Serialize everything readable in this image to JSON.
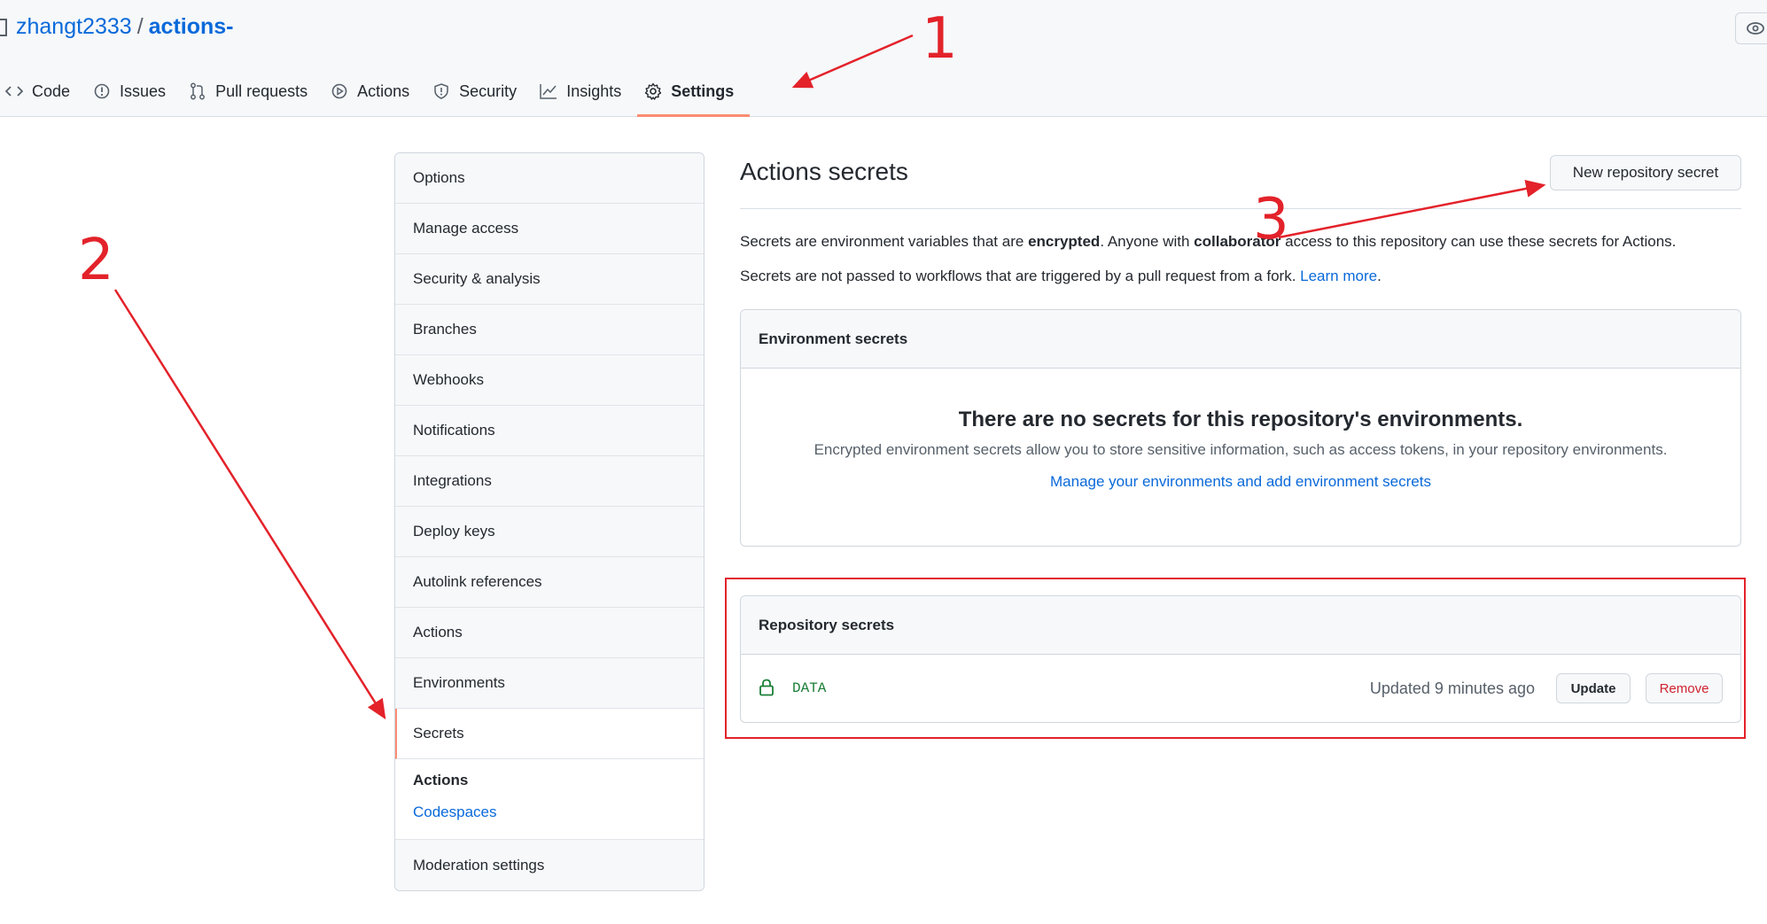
{
  "header": {
    "owner": "zhangt2333",
    "separator": "/",
    "repo": "actions-"
  },
  "tabs": [
    {
      "label": "Code",
      "icon": "code-icon"
    },
    {
      "label": "Issues",
      "icon": "issue-icon"
    },
    {
      "label": "Pull requests",
      "icon": "pull-request-icon"
    },
    {
      "label": "Actions",
      "icon": "play-icon"
    },
    {
      "label": "Security",
      "icon": "shield-icon"
    },
    {
      "label": "Insights",
      "icon": "graph-icon"
    },
    {
      "label": "Settings",
      "icon": "gear-icon",
      "selected": true
    }
  ],
  "sidebar": {
    "items": [
      {
        "label": "Options"
      },
      {
        "label": "Manage access"
      },
      {
        "label": "Security & analysis"
      },
      {
        "label": "Branches"
      },
      {
        "label": "Webhooks"
      },
      {
        "label": "Notifications"
      },
      {
        "label": "Integrations"
      },
      {
        "label": "Deploy keys"
      },
      {
        "label": "Autolink references"
      },
      {
        "label": "Actions"
      },
      {
        "label": "Environments"
      },
      {
        "label": "Secrets",
        "active": true
      }
    ],
    "group": {
      "title": "Actions",
      "link": "Codespaces"
    },
    "last_item": "Moderation settings"
  },
  "main": {
    "title": "Actions secrets",
    "new_secret_button": "New repository secret",
    "desc1": {
      "a": "Secrets are environment variables that are ",
      "b": "encrypted",
      "c": ". Anyone with ",
      "d": "collaborator",
      "e": " access to this repository can use these secrets for Actions."
    },
    "desc2": {
      "a": "Secrets are not passed to workflows that are triggered by a pull request from a fork. ",
      "link": "Learn more",
      "b": "."
    },
    "env": {
      "heading": "Environment secrets",
      "blank_title": "There are no secrets for this repository's environments.",
      "blank_text": "Encrypted environment secrets allow you to store sensitive information, such as access tokens, in your repository environments.",
      "blank_link": "Manage your environments and add environment secrets"
    },
    "repo_secrets": {
      "heading": "Repository secrets",
      "rows": [
        {
          "name": "DATA",
          "updated": "Updated 9 minutes ago",
          "update_label": "Update",
          "remove_label": "Remove"
        }
      ]
    }
  },
  "annotations": {
    "color": "#e3222a",
    "labels": [
      "1",
      "2",
      "3"
    ]
  },
  "colors": {
    "link": "#0969da",
    "selected_underline": "#fd8c73",
    "secret_name": "#1a7f37",
    "danger": "#cf222e"
  }
}
